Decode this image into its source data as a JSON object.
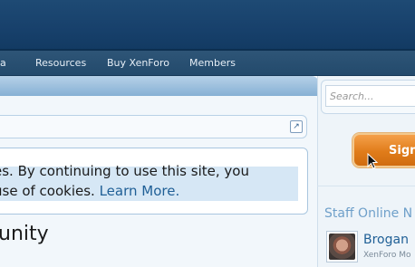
{
  "nav": {
    "items": [
      {
        "label": "ia"
      },
      {
        "label": "Resources"
      },
      {
        "label": "Buy XenForo"
      },
      {
        "label": "Members"
      }
    ]
  },
  "breadcrumb": {
    "icon": "external-link-icon"
  },
  "cookie_notice": {
    "line1": "es. By continuing to use this site, you",
    "line2_prefix": "use of cookies. ",
    "learn_more": "Learn More."
  },
  "page": {
    "title": "unity"
  },
  "sidebar": {
    "search_placeholder": "Search...",
    "signup_label": "Sign",
    "staff_online_title": "Staff Online N",
    "staff": [
      {
        "name": "Brogan",
        "role": "XenForo Mo"
      }
    ]
  },
  "colors": {
    "header": "#17406b",
    "navbar": "#2a5074",
    "accent": "#e07c1a",
    "link": "#1f5f96",
    "sidebar_heading": "#6fa0ca"
  }
}
